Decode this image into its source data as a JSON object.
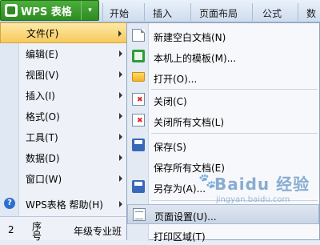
{
  "app": {
    "title": "WPS 表格",
    "caret": "▾"
  },
  "tabs": [
    "开始",
    "插入",
    "页面布局",
    "公式",
    "数据"
  ],
  "menu": {
    "items": [
      {
        "label": "文件(F)",
        "active": true
      },
      {
        "label": "编辑(E)"
      },
      {
        "label": "视图(V)"
      },
      {
        "label": "插入(I)"
      },
      {
        "label": "格式(O)"
      },
      {
        "label": "工具(T)"
      },
      {
        "label": "数据(D)"
      },
      {
        "label": "窗口(W)"
      },
      {
        "label": "WPS表格 帮助(H)"
      }
    ]
  },
  "submenu": {
    "items": [
      {
        "label": "新建空白文档(N)",
        "icon": "new-document-icon"
      },
      {
        "label": "本机上的模板(M)...",
        "icon": "template-icon"
      },
      {
        "label": "打开(O)...",
        "icon": "open-folder-icon"
      },
      {
        "label": "关闭(C)",
        "icon": "close-document-icon"
      },
      {
        "label": "关闭所有文档(L)",
        "icon": "close-all-icon"
      },
      {
        "label": "保存(S)",
        "icon": "save-icon"
      },
      {
        "label": "保存所有文档(E)",
        "icon": ""
      },
      {
        "label": "另存为(A)...",
        "icon": "save-as-icon"
      },
      {
        "label": "页面设置(U)...",
        "icon": "page-setup-icon"
      },
      {
        "label": "打印区域(T)",
        "icon": ""
      }
    ]
  },
  "sheet": {
    "row_number": "2",
    "seq_header": "序号",
    "grade_text": "年级专业班"
  },
  "watermark": {
    "brand": "Baidu 经验",
    "url": "jingyan.baidu.com"
  },
  "colors": {
    "wps_green": "#2e8c21",
    "highlight": "#f7c95c"
  }
}
